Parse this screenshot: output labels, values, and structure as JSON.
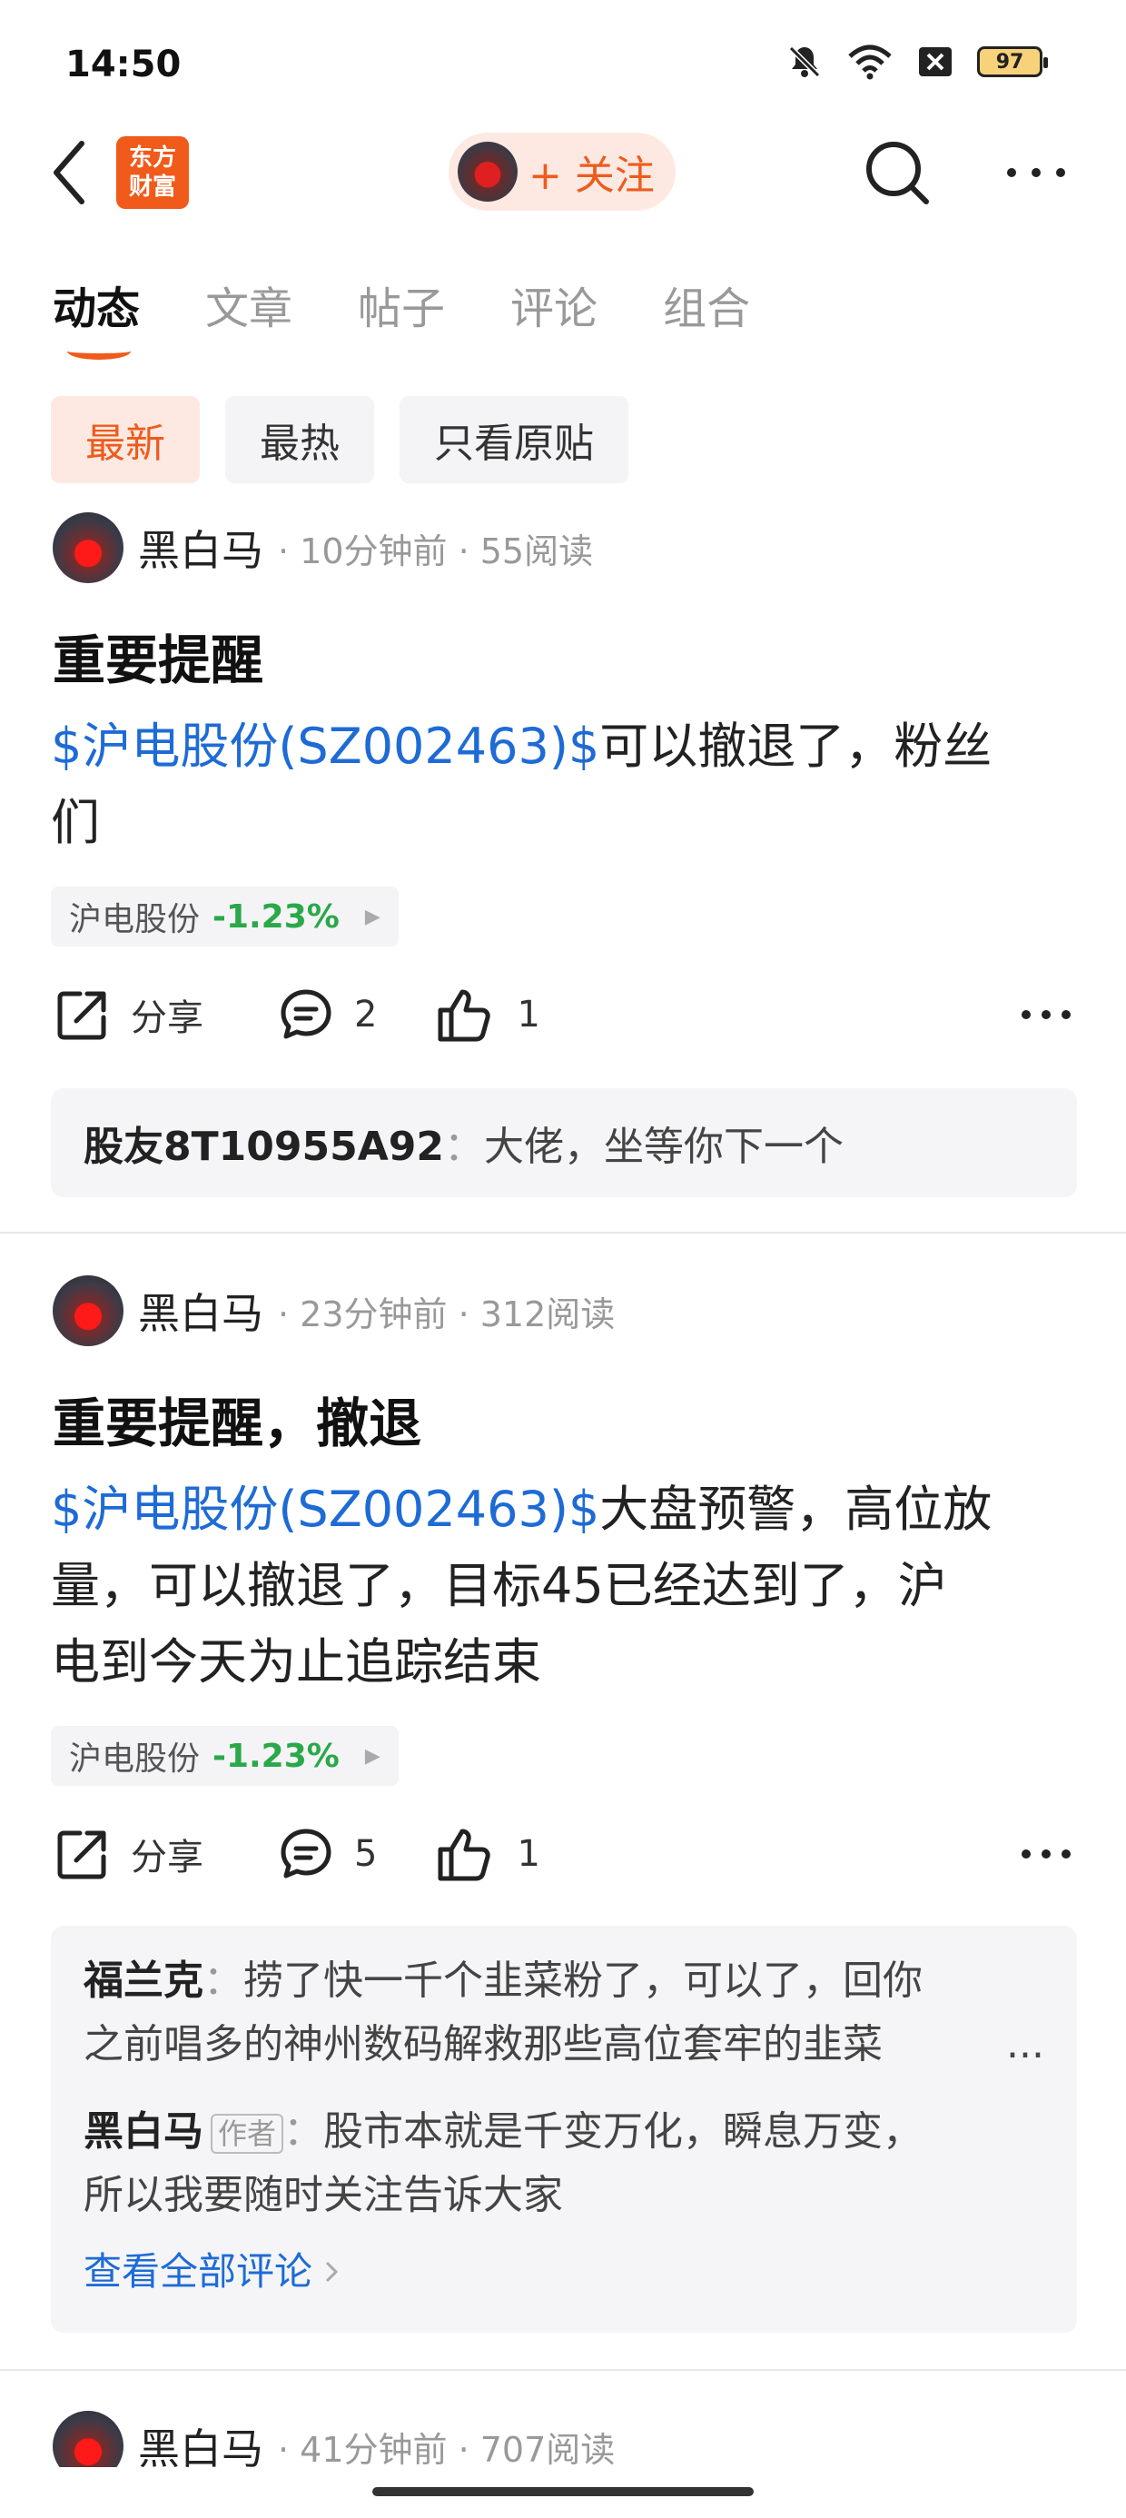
{
  "status_bar": {
    "time": "14:50",
    "battery": "97"
  },
  "header": {
    "logo_text_line1": "东方",
    "logo_text_line2": "财富",
    "follow_label": "+ 关注"
  },
  "tabs": [
    {
      "label": "动态",
      "active": true
    },
    {
      "label": "文章"
    },
    {
      "label": "帖子"
    },
    {
      "label": "评论"
    },
    {
      "label": "组合"
    }
  ],
  "filters": [
    {
      "label": "最新",
      "active": true
    },
    {
      "label": "最热"
    },
    {
      "label": "只看原贴"
    }
  ],
  "posts": [
    {
      "author": "黑白马",
      "meta": "· 10分钟前 · 55阅读",
      "title": "重要提醒",
      "stock_link": "$沪电股份(SZ002463)$",
      "body_line1_rest": "可以撤退了，粉丝",
      "body_line2": "们",
      "quote_name": "沪电股份",
      "quote_change": "-1.23%",
      "share_label": "分享",
      "comment_count": "2",
      "like_count": "1",
      "comments": [
        {
          "user": "股友8T10955A92",
          "sep": "：",
          "text": "大佬，坐等你下一个"
        }
      ]
    },
    {
      "author": "黑白马",
      "meta": "· 23分钟前 · 312阅读",
      "title": "重要提醒，撤退",
      "stock_link": "$沪电股份(SZ002463)$",
      "body_line1_rest": "大盘预警，高位放",
      "body_line2": "量，可以撤退了，目标45已经达到了，沪",
      "body_line3": "电到今天为止追踪结束",
      "quote_name": "沪电股份",
      "quote_change": "-1.23%",
      "share_label": "分享",
      "comment_count": "5",
      "like_count": "1",
      "comments": [
        {
          "user": "福兰克",
          "sep": "：",
          "line1": "捞了快一千个韭菜粉了，可以了，回你",
          "line2": "之前唱多的神州数码解救那些高位套牢的韭菜",
          "ellipsis": "..."
        },
        {
          "user": "黑白马",
          "tag": "作者",
          "sep": "：",
          "line1": "股市本就是千变万化，瞬息万变，",
          "line2": "所以我要随时关注告诉大家"
        }
      ],
      "view_all": "查看全部评论"
    },
    {
      "author": "黑白马",
      "meta": "· 41分钟前 · 707阅读"
    }
  ],
  "colors": {
    "accent": "#ee5b1d",
    "link": "#1e6bd6",
    "down": "#2aa84a"
  }
}
